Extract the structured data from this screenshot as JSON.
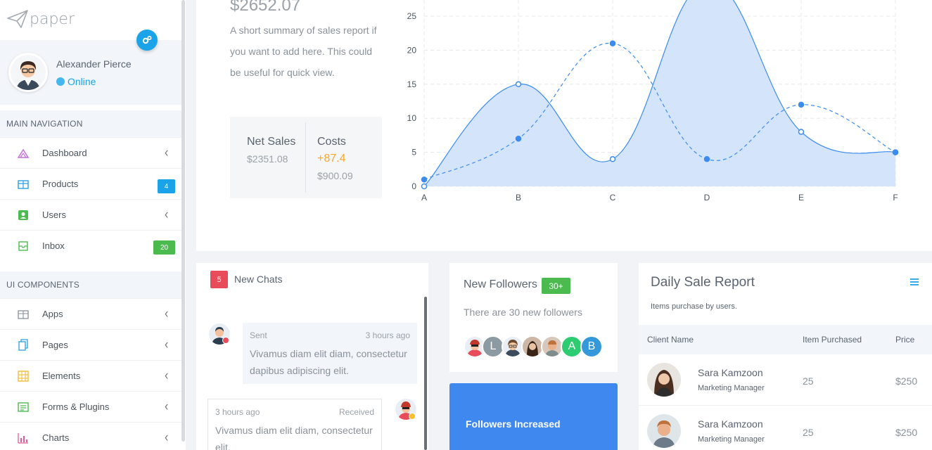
{
  "brand": {
    "logo_text": "paper"
  },
  "user": {
    "name": "Alexander Pierce",
    "status": "Online"
  },
  "nav": {
    "main_header": "MAIN NAVIGATION",
    "main_items": [
      {
        "label": "Dashboard",
        "icon": "dashboard-icon",
        "badge": null
      },
      {
        "label": "Products",
        "icon": "box-icon",
        "badge": "4",
        "badge_color": "#1aa3e8"
      },
      {
        "label": "Users",
        "icon": "user-icon",
        "badge": null
      },
      {
        "label": "Inbox",
        "icon": "inbox-icon",
        "badge": "20",
        "badge_color": "#4cbb4f"
      }
    ],
    "ui_header": "UI COMPONENTS",
    "ui_items": [
      {
        "label": "Apps",
        "icon": "apps-icon"
      },
      {
        "label": "Pages",
        "icon": "pages-icon"
      },
      {
        "label": "Elements",
        "icon": "elements-icon"
      },
      {
        "label": "Forms & Plugins",
        "icon": "forms-icon"
      },
      {
        "label": "Charts",
        "icon": "charts-icon"
      }
    ]
  },
  "sales": {
    "total": "$2652.07",
    "summary": "A short summary of sales report if you want to add here. This could be useful for quick view.",
    "net_title": "Net Sales",
    "net_value": "$2351.08",
    "costs_title": "Costs",
    "costs_change": "+87.4",
    "costs_value": "$900.09"
  },
  "chart_data": {
    "type": "area",
    "categories": [
      "A",
      "B",
      "C",
      "D",
      "E",
      "F"
    ],
    "ylim": [
      0,
      25
    ],
    "yticks": [
      0,
      5,
      10,
      15,
      20,
      25
    ],
    "grid": true,
    "series": [
      {
        "values": [
          0,
          15,
          4,
          30,
          8,
          5
        ],
        "style": "solid-filled",
        "color": "#3b8bf0"
      },
      {
        "values": [
          1,
          7,
          21,
          4,
          12,
          5
        ],
        "style": "dashed",
        "color": "#3b8bf0"
      }
    ]
  },
  "chats": {
    "count": "5",
    "title": "New Chats",
    "messages": [
      {
        "direction": "Sent",
        "time": "3 hours ago",
        "text": "Vivamus diam elit diam, consectetur dapibus adipiscing elit."
      },
      {
        "direction": "Received",
        "time": "3 hours ago",
        "text": "Vivamus diam elit diam, consectetur elit."
      }
    ]
  },
  "followers": {
    "title": "New Followers",
    "badge": "30+",
    "subtitle": "There are 30 new followers",
    "letters": [
      "L",
      "A",
      "B"
    ],
    "increased_label": "Followers Increased"
  },
  "daily_sale": {
    "title": "Daily Sale Report",
    "subtitle": "Items purchase by users.",
    "headers": [
      "Client Name",
      "Item Purchased",
      "Price"
    ],
    "rows": [
      {
        "name": "Sara Kamzoon",
        "role": "Marketing Manager",
        "qty": "25",
        "price": "$250"
      },
      {
        "name": "Sara Kamzoon",
        "role": "Marketing Manager",
        "qty": "25",
        "price": "$250"
      }
    ]
  }
}
